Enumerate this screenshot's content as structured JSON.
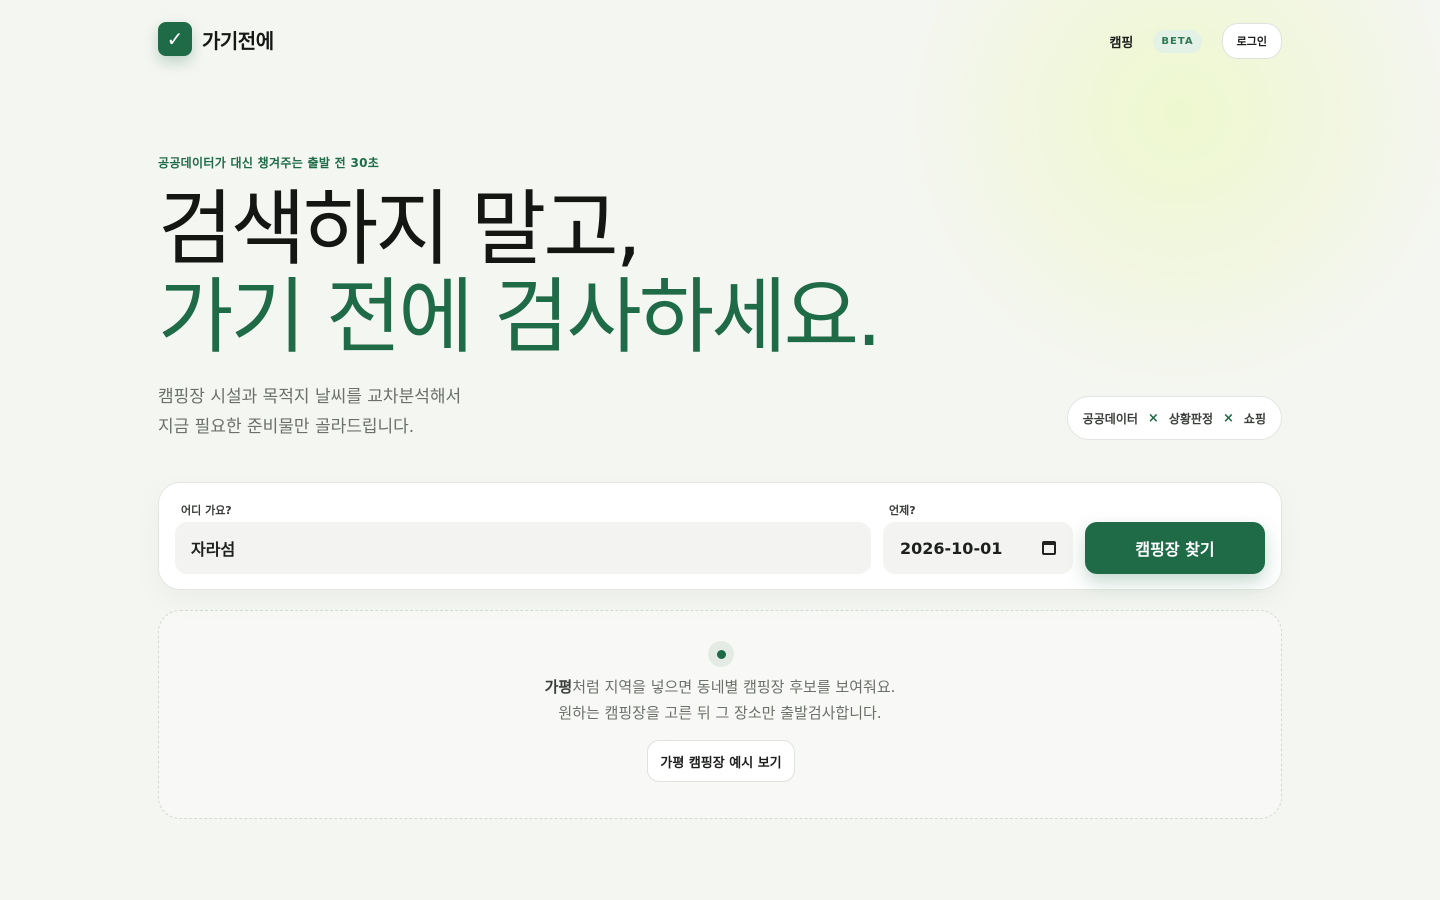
{
  "header": {
    "logo_check": "✓",
    "logo_text": "가기전에",
    "nav_camping": "캠핑",
    "beta_badge": "BETA",
    "login_label": "로그인"
  },
  "hero": {
    "eyebrow": "공공데이터가 대신 챙겨주는 출발 전 30초",
    "headline_line1": "검색하지 말고,",
    "headline_line2": "가기 전에 검사하세요.",
    "lead_line1": "캠핑장 시설과 목적지 날씨를 교차분석해서",
    "lead_line2": "지금 필요한 준비물만 골라드립니다."
  },
  "tags": {
    "items": [
      "공공데이터",
      "상황판정",
      "쇼핑"
    ],
    "separator": "×"
  },
  "search": {
    "where_label": "어디 가요?",
    "where_value": "자라섬",
    "when_label": "언제?",
    "when_value": "2026-10-01",
    "submit_label": "캠핑장 찾기"
  },
  "empty_state": {
    "line1_bold": "가평",
    "line1_rest": "처럼 지역을 넣으면 동네별 캠핑장 후보를 보여줘요.",
    "line2": "원하는 캠핑장을 고른 뒤 그 장소만 출발검사합니다.",
    "example_button": "가평 캠핑장 예시 보기"
  },
  "colors": {
    "brand": "#1f6b47",
    "background": "#f4f6f2"
  }
}
